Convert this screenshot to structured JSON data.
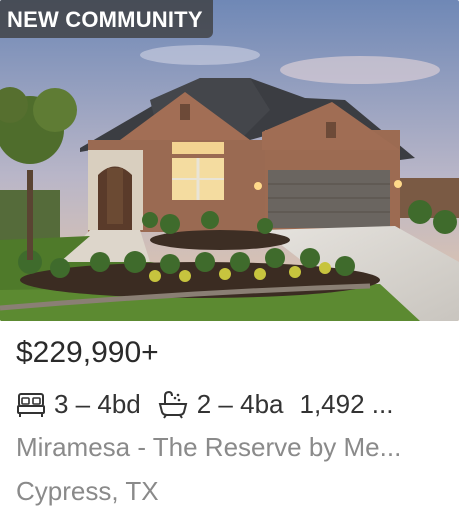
{
  "listing": {
    "badge": "NEW COMMUNITY",
    "price": "$229,990+",
    "beds": "3 – 4bd",
    "baths": "2 – 4ba",
    "sqft": "1,492 ...",
    "community": "Miramesa - The Reserve by Me...",
    "location": "Cypress, TX"
  },
  "icons": {
    "bed": "bed-icon",
    "bath": "bathtub-icon"
  },
  "colors": {
    "badge_bg": "#3c3c3c",
    "price_text": "#2a2a2a",
    "muted_text": "#8a8a8a"
  }
}
